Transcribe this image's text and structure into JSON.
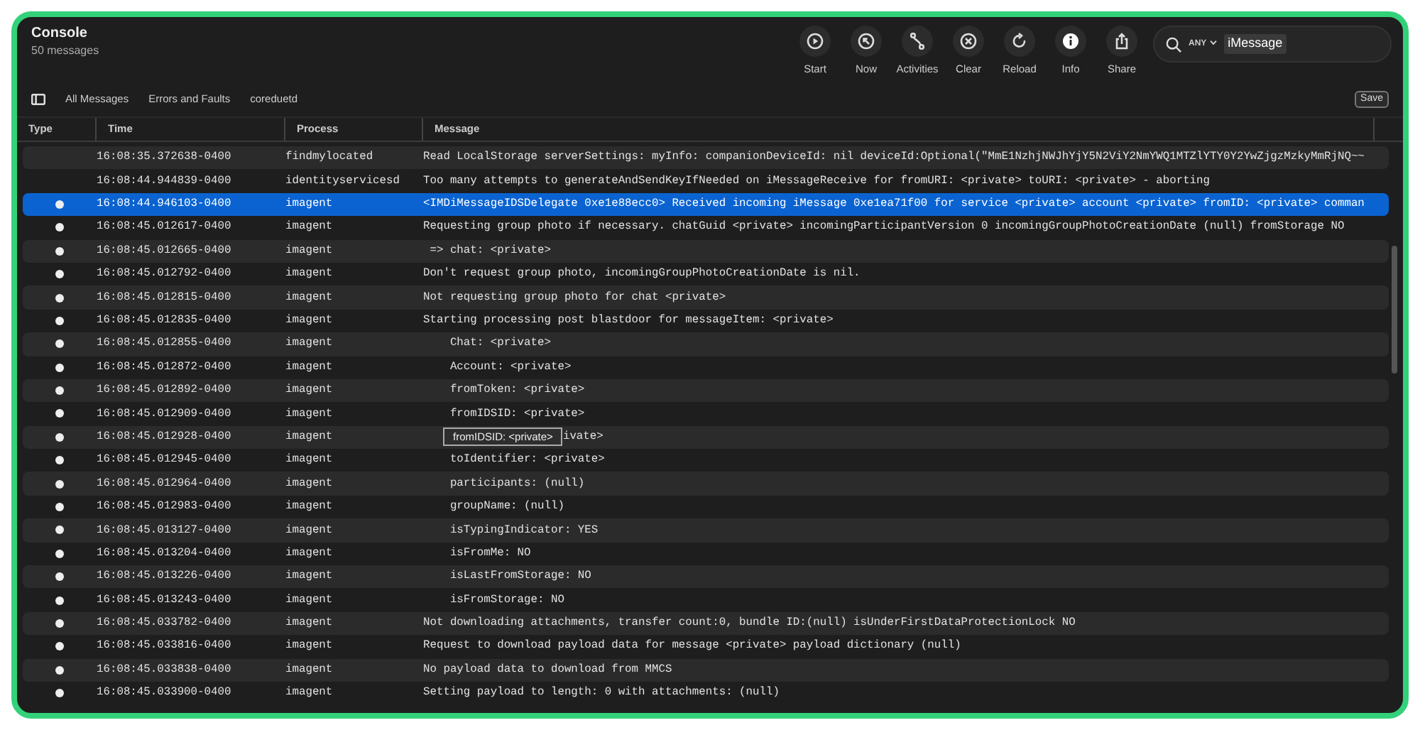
{
  "window": {
    "title": "Console",
    "subtitle": "50 messages"
  },
  "toolbar": [
    {
      "label": "Start",
      "kind": "play"
    },
    {
      "label": "Now",
      "kind": "now"
    },
    {
      "label": "Activities",
      "kind": "activities"
    },
    {
      "label": "Clear",
      "kind": "clear"
    },
    {
      "label": "Reload",
      "kind": "reload"
    },
    {
      "label": "Info",
      "kind": "info"
    },
    {
      "label": "Share",
      "kind": "share"
    }
  ],
  "search": {
    "scope": "ANY",
    "token": "iMessage"
  },
  "filters": [
    {
      "label": "All Messages"
    },
    {
      "label": "Errors and Faults"
    },
    {
      "label": "coreduetd"
    }
  ],
  "save_button": "Save",
  "table": {
    "columns": [
      "Type",
      "Time",
      "Process",
      "Message"
    ],
    "rows": [
      {
        "dot": false,
        "selected": false,
        "time": "16:08:35.372638-0400",
        "process": "findmylocated",
        "message": "Read LocalStorage serverSettings: myInfo: companionDeviceId: nil deviceId:Optional(\"MmE1NzhjNWJhYjY5N2ViY2NmYWQ1MTZlYTY0Y2YwZjgzMzkyMmRjNQ~~"
      },
      {
        "dot": false,
        "selected": false,
        "time": "16:08:44.944839-0400",
        "process": "identityservicesd",
        "message": "Too many attempts to generateAndSendKeyIfNeeded on iMessageReceive for fromURI: <private> toURI: <private> - aborting"
      },
      {
        "dot": true,
        "selected": true,
        "time": "16:08:44.946103-0400",
        "process": "imagent",
        "message": "<IMDiMessageIDSDelegate 0xe1e88ecc0> Received incoming iMessage 0xe1ea71f00 for service <private> account <private> fromID: <private> comman"
      },
      {
        "dot": true,
        "selected": false,
        "time": "16:08:45.012617-0400",
        "process": "imagent",
        "message": "Requesting group photo if necessary. chatGuid <private> incomingParticipantVersion 0 incomingGroupPhotoCreationDate (null) fromStorage NO"
      },
      {
        "dot": true,
        "selected": false,
        "time": "16:08:45.012665-0400",
        "process": "imagent",
        "message": " => chat: <private>"
      },
      {
        "dot": true,
        "selected": false,
        "time": "16:08:45.012792-0400",
        "process": "imagent",
        "message": "Don't request group photo, incomingGroupPhotoCreationDate is nil."
      },
      {
        "dot": true,
        "selected": false,
        "time": "16:08:45.012815-0400",
        "process": "imagent",
        "message": "Not requesting group photo for chat <private>"
      },
      {
        "dot": true,
        "selected": false,
        "time": "16:08:45.012835-0400",
        "process": "imagent",
        "message": "Starting processing post blastdoor for messageItem: <private>"
      },
      {
        "dot": true,
        "selected": false,
        "time": "16:08:45.012855-0400",
        "process": "imagent",
        "message": "    Chat: <private>"
      },
      {
        "dot": true,
        "selected": false,
        "time": "16:08:45.012872-0400",
        "process": "imagent",
        "message": "    Account: <private>"
      },
      {
        "dot": true,
        "selected": false,
        "time": "16:08:45.012892-0400",
        "process": "imagent",
        "message": "    fromToken: <private>"
      },
      {
        "dot": true,
        "selected": false,
        "time": "16:08:45.012909-0400",
        "process": "imagent",
        "message": "    fromIDSID: <private>"
      },
      {
        "dot": true,
        "selected": false,
        "time": "16:08:45.012928-0400",
        "process": "imagent",
        "message": "ivate>",
        "tooltip": "fromIDSID: <private>"
      },
      {
        "dot": true,
        "selected": false,
        "time": "16:08:45.012945-0400",
        "process": "imagent",
        "message": "    toIdentifier: <private>"
      },
      {
        "dot": true,
        "selected": false,
        "time": "16:08:45.012964-0400",
        "process": "imagent",
        "message": "    participants: (null)"
      },
      {
        "dot": true,
        "selected": false,
        "time": "16:08:45.012983-0400",
        "process": "imagent",
        "message": "    groupName: (null)"
      },
      {
        "dot": true,
        "selected": false,
        "time": "16:08:45.013127-0400",
        "process": "imagent",
        "message": "    isTypingIndicator: YES"
      },
      {
        "dot": true,
        "selected": false,
        "time": "16:08:45.013204-0400",
        "process": "imagent",
        "message": "    isFromMe: NO"
      },
      {
        "dot": true,
        "selected": false,
        "time": "16:08:45.013226-0400",
        "process": "imagent",
        "message": "    isLastFromStorage: NO"
      },
      {
        "dot": true,
        "selected": false,
        "time": "16:08:45.013243-0400",
        "process": "imagent",
        "message": "    isFromStorage: NO"
      },
      {
        "dot": true,
        "selected": false,
        "time": "16:08:45.033782-0400",
        "process": "imagent",
        "message": "Not downloading attachments, transfer count:0, bundle ID:(null) isUnderFirstDataProtectionLock NO"
      },
      {
        "dot": true,
        "selected": false,
        "time": "16:08:45.033816-0400",
        "process": "imagent",
        "message": "Request to download payload data for message <private> payload dictionary (null)"
      },
      {
        "dot": true,
        "selected": false,
        "time": "16:08:45.033838-0400",
        "process": "imagent",
        "message": "No payload data to download from MMCS"
      },
      {
        "dot": true,
        "selected": false,
        "time": "16:08:45.033900-0400",
        "process": "imagent",
        "message": "Setting payload to length: 0 with attachments: (null)"
      }
    ]
  }
}
